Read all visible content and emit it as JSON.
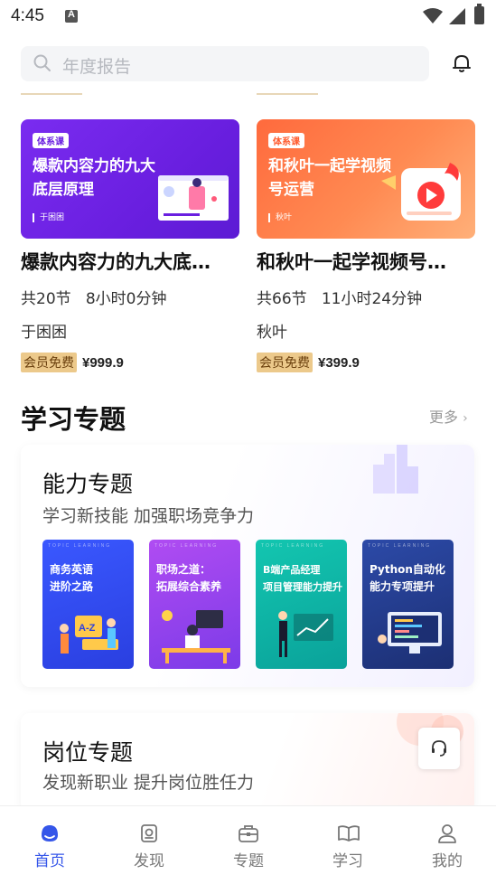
{
  "status_bar": {
    "time": "4:45"
  },
  "search": {
    "placeholder": "年度报告"
  },
  "courses": [
    {
      "brand": "体系课",
      "cover_headline": "爆款内容力的九大底层原理",
      "cover_author": "于困困",
      "title": "爆款内容力的九大底…",
      "lessons": "共20节",
      "duration": "8小时0分钟",
      "teacher": "于困困",
      "vip_label": "会员免费",
      "price": "¥999.9",
      "accent": "#6a1fe0"
    },
    {
      "brand": "体系课",
      "cover_headline": "和秋叶一起学视频号运营",
      "cover_author": "秋叶",
      "title": "和秋叶一起学视频号…",
      "lessons": "共66节",
      "duration": "11小时24分钟",
      "teacher": "秋叶",
      "vip_label": "会员免费",
      "price": "¥399.9",
      "accent": "#ff6a3d"
    }
  ],
  "topics_section": {
    "title": "学习专题",
    "more": "更多"
  },
  "ability_panel": {
    "title": "能力专题",
    "subtitle": "学习新技能 加强职场竞争力",
    "tile_tag": "TOPIC LEARNING",
    "tiles": [
      {
        "title": "商务英语\n进阶之路"
      },
      {
        "title": "职场之道：\n拓展综合素养"
      },
      {
        "title": "B端产品经理\n项目管理能力提升"
      },
      {
        "title": "Python自动化\n能力专项提升"
      }
    ]
  },
  "job_panel": {
    "title": "岗位专题",
    "subtitle": "发现新职业 提升岗位胜任力"
  },
  "tabbar": {
    "active_color": "#3556e9",
    "items": [
      {
        "label": "首页",
        "icon": "home-icon"
      },
      {
        "label": "发现",
        "icon": "discover-icon"
      },
      {
        "label": "专题",
        "icon": "topic-icon"
      },
      {
        "label": "学习",
        "icon": "study-icon"
      },
      {
        "label": "我的",
        "icon": "profile-icon"
      }
    ]
  }
}
